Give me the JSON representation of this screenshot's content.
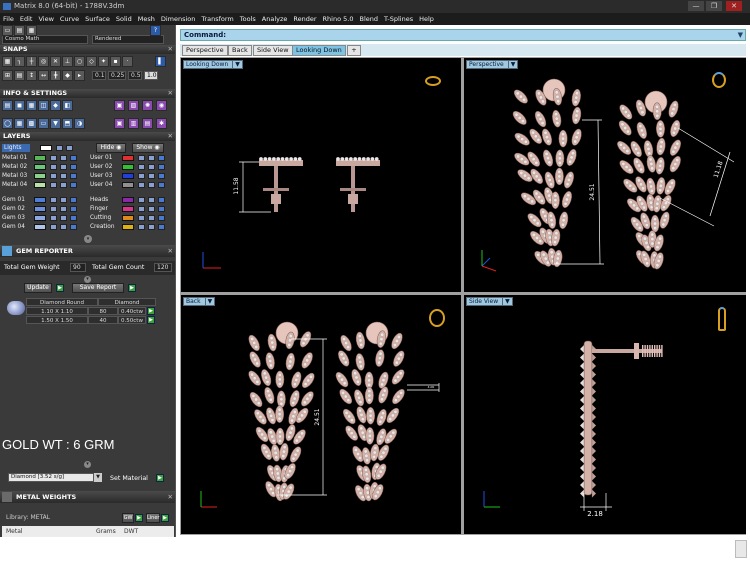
{
  "window": {
    "title": "Matrix 8.0 (64-bit) - 1788V.3dm",
    "buttons": [
      "—",
      "❐",
      "✕"
    ]
  },
  "menu": [
    "File",
    "Edit",
    "View",
    "Curve",
    "Surface",
    "Solid",
    "Mesh",
    "Dimension",
    "Transform",
    "Tools",
    "Analyze",
    "Render",
    "Rhino 5.0",
    "Blend",
    "T-Splines",
    "Help"
  ],
  "top_fields": {
    "display_mode": "Cosmo Math",
    "render_mode": "Rendered"
  },
  "panels": {
    "snaps": "SNAPS",
    "snap_values": [
      "0.1",
      "0.25",
      "0.5",
      "1.0"
    ],
    "info": "INFO & SETTINGS",
    "layers": "LAYERS"
  },
  "layers": {
    "lights_label": "Lights",
    "hide_label": "Hide",
    "show_label": "Show",
    "left": [
      {
        "name": "Metal 01",
        "color": "#58b858"
      },
      {
        "name": "Metal 02",
        "color": "#69c779"
      },
      {
        "name": "Metal 03",
        "color": "#89d089"
      },
      {
        "name": "Metal 04",
        "color": "#b9e0a9"
      },
      {
        "name": "Gem 01",
        "color": "#4f7fd8"
      },
      {
        "name": "Gem 02",
        "color": "#6d8fe0"
      },
      {
        "name": "Gem 03",
        "color": "#8ea8e4"
      },
      {
        "name": "Gem 04",
        "color": "#b0c4ea"
      }
    ],
    "right": [
      {
        "name": "User 01",
        "color": "#e03030"
      },
      {
        "name": "User 02",
        "color": "#30c030"
      },
      {
        "name": "User 03",
        "color": "#2040d8"
      },
      {
        "name": "User 04",
        "color": "#909090"
      },
      {
        "name": "Heads",
        "color": "#8a2aa8"
      },
      {
        "name": "Finger",
        "color": "#d8368c"
      },
      {
        "name": "Cutting",
        "color": "#e08a1a"
      },
      {
        "name": "Creation",
        "color": "#e0b010"
      }
    ]
  },
  "gem_reporter": {
    "title": "GEM REPORTER",
    "total_weight_label": "Total Gem Weight",
    "total_weight_value": "90",
    "total_count_label": "Total Gem Count",
    "total_count_value": "120",
    "update_label": "Update",
    "save_label": "Save Report",
    "table_header": [
      "Diamond Round",
      "Diamond"
    ],
    "rows": [
      {
        "size": "1.10 X 1.10",
        "count": "80",
        "weight": "0.40ctw"
      },
      {
        "size": "1.50 X 1.50",
        "count": "40",
        "weight": "0.50ctw"
      }
    ],
    "gold_weight": "GOLD WT : 6 GRM",
    "material_select": "Diamond   [3.52 s/g]",
    "set_material_label": "Set Material"
  },
  "metal_weights": {
    "title": "METAL WEIGHTS",
    "library_label": "Library: METAL",
    "gw_label": "GW",
    "liner_label": "Liner",
    "col_metal": "Metal",
    "col_grams": "Grams",
    "col_dwt": "DWT"
  },
  "command": {
    "label": "Command:"
  },
  "tabs": [
    {
      "label": "Perspective",
      "active": false
    },
    {
      "label": "Back",
      "active": false
    },
    {
      "label": "Side View",
      "active": false
    },
    {
      "label": "Looking Down",
      "active": true
    },
    {
      "label": "+",
      "active": false
    }
  ],
  "viewports": [
    {
      "label": "Looking Down",
      "dims": [
        "11.58"
      ]
    },
    {
      "label": "Perspective",
      "dims": [
        "24.51",
        "11.18"
      ]
    },
    {
      "label": "Back",
      "dims": [
        "24.51",
        "4.00"
      ]
    },
    {
      "label": "Side View",
      "dims": [
        "2.18"
      ]
    }
  ],
  "colors": {
    "metal": "#d4b2a8",
    "stone": "#ece6e6",
    "dim_line": "#ffffff",
    "axis_x": "#e02020",
    "axis_y": "#2050e0",
    "label_bg": "#9ec9e0"
  }
}
